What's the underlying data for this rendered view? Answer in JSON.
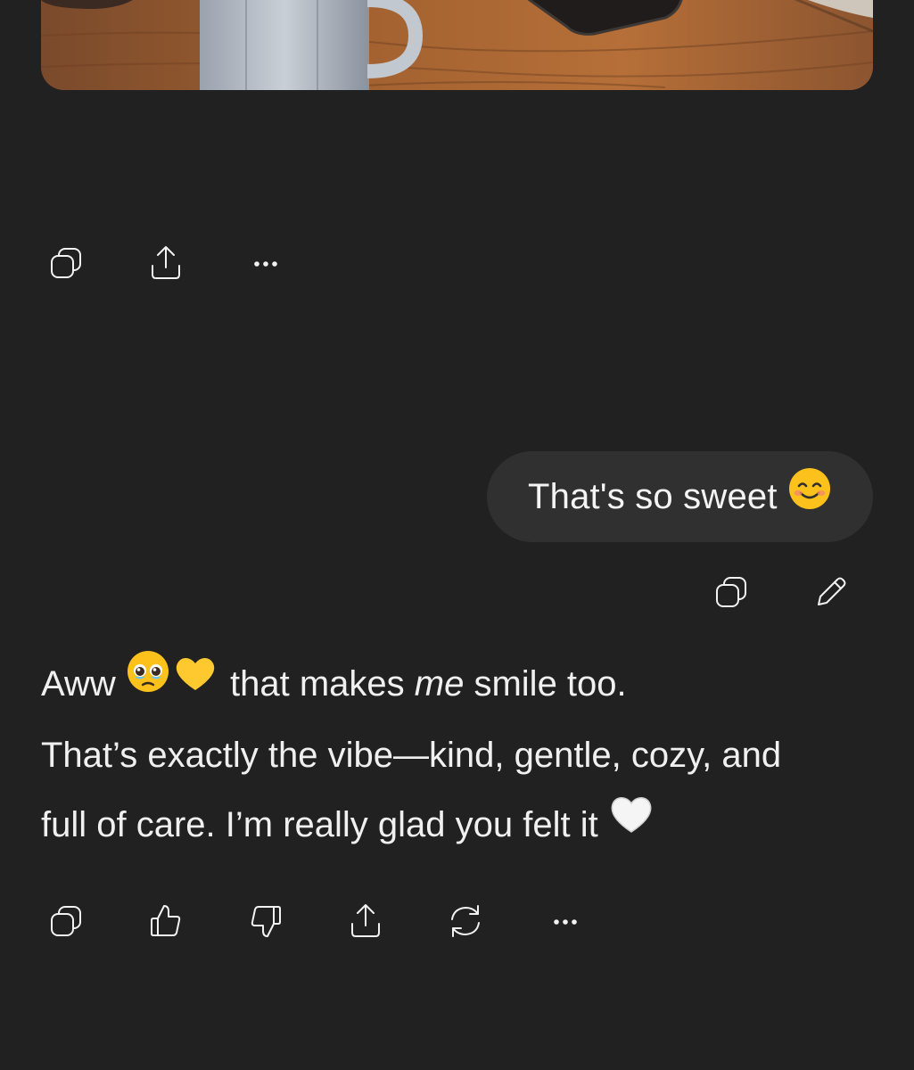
{
  "image_card": {
    "icon": "generated-image-coffee-mug-and-phone"
  },
  "image_actions": {
    "copy_icon": "copy-icon",
    "share_icon": "share-icon",
    "more_icon": "more-options-icon"
  },
  "user_message": {
    "text": "That's so sweet",
    "emoji": "smiling-face-with-smiling-eyes"
  },
  "user_actions": {
    "copy_icon": "copy-icon",
    "edit_icon": "pencil-edit-icon"
  },
  "assistant_message": {
    "line1_start": "Aww",
    "line1_emoji": "pleading-face-and-yellow-heart",
    "line1_mid": "that makes",
    "line1_em": "me",
    "line1_end": "smile too.",
    "line2": "That’s exactly the vibe—kind, gentle, cozy, and",
    "line3": "full of care. I’m really glad you felt it",
    "line3_emoji": "white-heart"
  },
  "assistant_actions": {
    "copy_icon": "copy-icon",
    "thumbs_up_icon": "thumbs-up-icon",
    "thumbs_down_icon": "thumbs-down-icon",
    "share_icon": "share-icon",
    "regenerate_icon": "regenerate-icon",
    "more_icon": "more-options-icon"
  },
  "colors": {
    "background": "#212121",
    "bubble": "#303030",
    "text": "#ececec",
    "icon": "#f2f2f2"
  }
}
